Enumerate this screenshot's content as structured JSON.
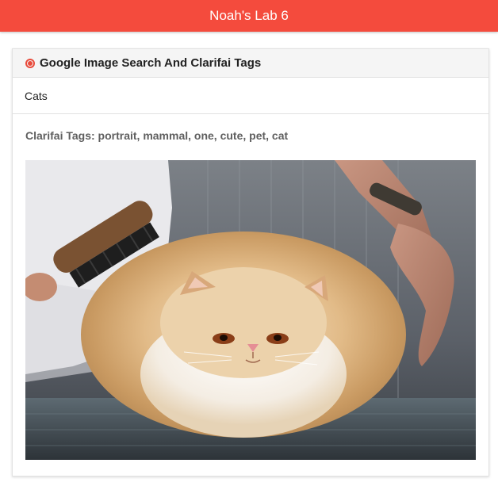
{
  "app": {
    "title": "Noah's Lab 6",
    "accent_color": "#f44b3d"
  },
  "card": {
    "title": "Google Image Search And Clarifai Tags",
    "icon": "radio-dot-icon"
  },
  "search": {
    "value": "Cats",
    "placeholder": ""
  },
  "tags": {
    "label": "Clarifai Tags:",
    "items": [
      "portrait",
      "mammal",
      "one",
      "cute",
      "pet",
      "cat"
    ],
    "text": "Clarifai Tags: portrait, mammal, one, cute, pet, cat"
  },
  "result_image": {
    "subject": "fluffy cream Persian cat being brushed"
  }
}
